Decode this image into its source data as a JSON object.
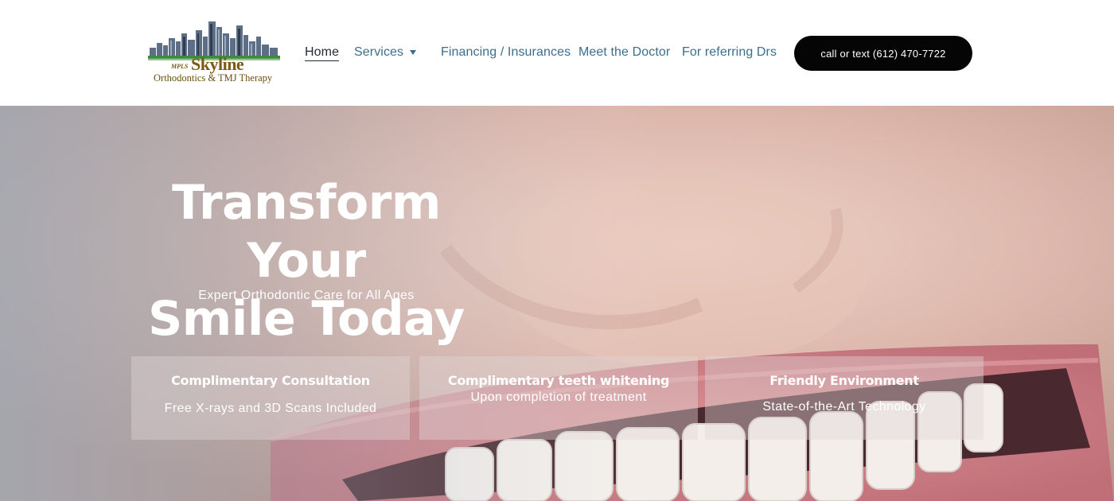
{
  "header": {
    "logo": {
      "prefix": "MPLS",
      "brand": "Skyline",
      "tagline": "Orthodontics & TMJ Therapy"
    },
    "nav": {
      "home": "Home",
      "services": "Services",
      "financing": "Financing / Insurances",
      "doctor": "Meet the Doctor",
      "referring": "For referring Drs"
    },
    "cta": "call or text (612) 470-7722"
  },
  "hero": {
    "title_line1": "Transform Your",
    "title_line2": "Smile Today",
    "subtitle": "Expert Orthodontic Care for All Ages",
    "cards": [
      {
        "title": "Complimentary Consultation",
        "text": "Free X-rays and 3D Scans Included"
      },
      {
        "title": "Complimentary teeth whitening",
        "text": "Upon completion of treatment"
      },
      {
        "title": "Friendly Environment",
        "text": "State-of-the-Art Technology"
      }
    ]
  },
  "colors": {
    "nav_link": "#3c6e8c",
    "nav_active": "#1f2a33",
    "cta_bg": "#050505",
    "logo_gold": "#7a5a14"
  }
}
